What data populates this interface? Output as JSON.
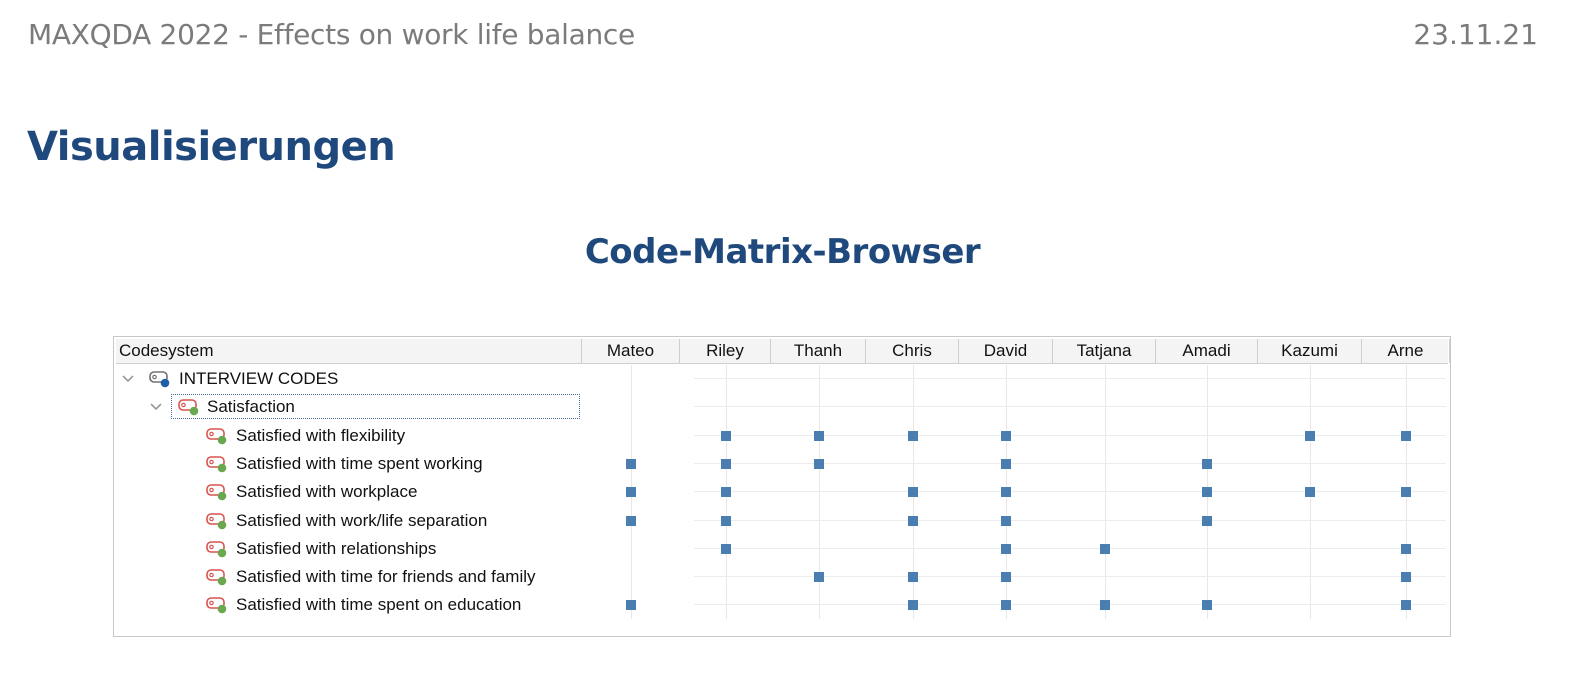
{
  "header": {
    "title": "MAXQDA 2022 - Effects on work life balance",
    "date": "23.11.21"
  },
  "section_title": "Visualisierungen",
  "subtitle": "Code-Matrix-Browser",
  "matrix": {
    "codesystem_label": "Codesystem",
    "columns": [
      "Mateo",
      "Riley",
      "Thanh",
      "Chris",
      "David",
      "Tatjana",
      "Amadi",
      "Kazumi",
      "Arne"
    ],
    "root": {
      "label": "INTERVIEW CODES",
      "icon": "code-tag-blue-icon"
    },
    "parent": {
      "label": "Satisfaction",
      "icon": "code-tag-green-icon",
      "selected": true
    },
    "rows": [
      {
        "label": "Satisfied with flexibility",
        "cells": [
          0,
          1,
          1,
          1,
          1,
          0,
          0,
          1,
          1
        ]
      },
      {
        "label": "Satisfied with time spent working",
        "cells": [
          1,
          1,
          1,
          0,
          1,
          0,
          1,
          0,
          0
        ]
      },
      {
        "label": "Satisfied with workplace",
        "cells": [
          1,
          1,
          0,
          1,
          1,
          0,
          1,
          1,
          1
        ]
      },
      {
        "label": "Satisfied with work/life separation",
        "cells": [
          1,
          1,
          0,
          1,
          1,
          0,
          1,
          0,
          0
        ]
      },
      {
        "label": "Satisfied with relationships",
        "cells": [
          0,
          1,
          0,
          0,
          1,
          1,
          0,
          0,
          1
        ]
      },
      {
        "label": "Satisfied with time for friends and family",
        "cells": [
          0,
          0,
          1,
          1,
          1,
          0,
          0,
          0,
          1
        ]
      },
      {
        "label": "Satisfied with time spent on education",
        "cells": [
          1,
          0,
          0,
          1,
          1,
          1,
          1,
          0,
          1
        ]
      }
    ],
    "colors": {
      "mark": "#4a7eb0",
      "tag_red": "#d9534f",
      "dot_green": "#6aa84f",
      "dot_blue": "#1f5fa8"
    }
  }
}
